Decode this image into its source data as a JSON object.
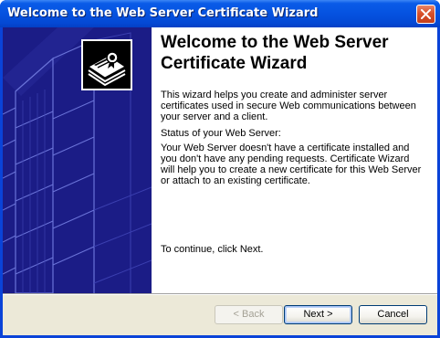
{
  "window": {
    "title": "Welcome to the Web Server Certificate Wizard"
  },
  "content": {
    "heading": "Welcome to the Web Server Certificate Wizard",
    "intro": "This wizard helps you create and administer server certificates used in secure Web communications between your server and a client.",
    "status_label": "Status of your Web Server:",
    "status_text": "Your Web Server doesn't have a certificate installed and you don't have any pending requests. Certificate Wizard will help you to create a new certificate for this Web Server or attach to an existing certificate.",
    "continue_text": "To continue, click Next."
  },
  "buttons": {
    "back_label": "< Back",
    "next_label": "Next >",
    "cancel_label": "Cancel"
  },
  "icons": {
    "close": "close-icon",
    "certificate": "certificate-icon"
  },
  "colors": {
    "titlebar": "#0552e0",
    "side_panel": "#1b1c86",
    "footer": "#ece9d8"
  }
}
